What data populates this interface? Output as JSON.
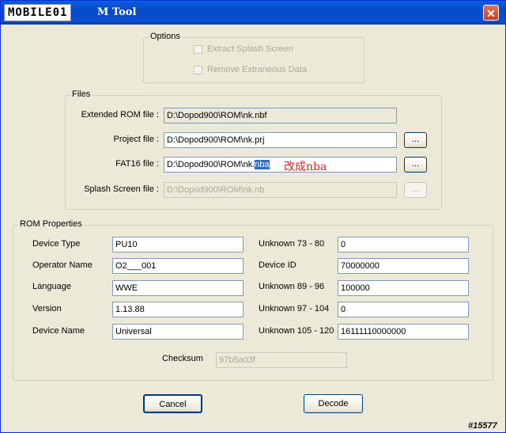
{
  "window": {
    "logo_text": "MOBILE01",
    "title": "M Tool",
    "close_symbol": "✕"
  },
  "options": {
    "legend": "Options",
    "extract_splash": {
      "label": "Extract Splash Screen",
      "checked": false,
      "enabled": false
    },
    "remove_extraneous": {
      "label": "Remove Extraneous Data",
      "checked": false,
      "enabled": false
    }
  },
  "files": {
    "legend": "Files",
    "extended_rom": {
      "label": "Extended ROM file :",
      "value": "D:\\Dopod900\\ROM\\nk.nbf"
    },
    "project": {
      "label": "Project file :",
      "value": "D:\\Dopod900\\ROM\\nk.prj",
      "browse": "..."
    },
    "fat16": {
      "label": "FAT16 file :",
      "value_prefix": "D:\\Dopod900\\ROM\\nk.",
      "value_selected": "nba",
      "browse": "..."
    },
    "splash": {
      "label": "Splash Screen file :",
      "value": "D:\\Dopod900\\ROM\\nk.nb",
      "browse": "..."
    },
    "annotation": "改成nba"
  },
  "rom": {
    "legend": "ROM Properties",
    "left": [
      {
        "label": "Device Type",
        "value": "PU10"
      },
      {
        "label": "Operator Name",
        "value": "O2___001"
      },
      {
        "label": "Language",
        "value": "WWE"
      },
      {
        "label": "Version",
        "value": "1.13.88"
      },
      {
        "label": "Device Name",
        "value": "Universal"
      }
    ],
    "right": [
      {
        "label": "Unknown 73 - 80",
        "value": "0"
      },
      {
        "label": "Device ID",
        "value": "70000000"
      },
      {
        "label": "Unknown 89 - 96",
        "value": "100000"
      },
      {
        "label": "Unknown 97 - 104",
        "value": "0"
      },
      {
        "label": "Unknown 105 - 120",
        "value": "16111110000000"
      }
    ],
    "checksum": {
      "label": "Checksum",
      "value": "97b5a03f"
    }
  },
  "buttons": {
    "cancel": "Cancel",
    "decode": "Decode"
  },
  "watermark": "#15577",
  "colors": {
    "titlebar": "#0548c8",
    "dialog_bg": "#ece9d8",
    "selection": "#316ac5",
    "annotation": "#e02020"
  }
}
